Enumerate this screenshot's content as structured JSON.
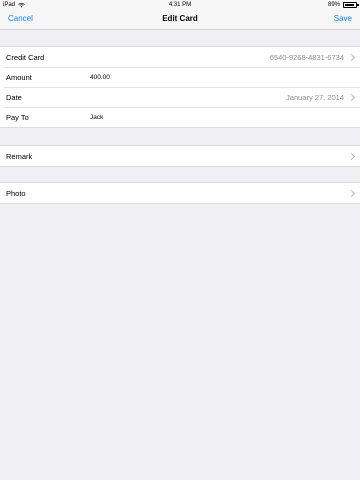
{
  "status_bar": {
    "device": "iPad",
    "time": "4:31 PM",
    "battery_percent": "89%",
    "battery_level": 0.89,
    "wifi_icon": "wifi-icon"
  },
  "nav": {
    "cancel_label": "Cancel",
    "title": "Edit Card",
    "save_label": "Save",
    "accent_color": "#1a7efb"
  },
  "form": {
    "credit_card_label": "Credit Card",
    "credit_card_value": "6540-9268-4831-6734",
    "amount_label": "Amount",
    "amount_value": "400.00",
    "date_label": "Date",
    "date_value": "January 27, 2014",
    "pay_to_label": "Pay To",
    "pay_to_value": "Jack"
  },
  "remark": {
    "label": "Remark"
  },
  "photo": {
    "label": "Photo"
  }
}
